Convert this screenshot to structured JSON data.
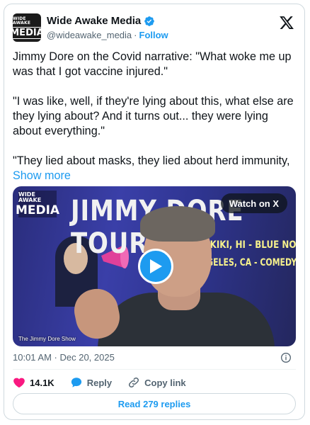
{
  "author": {
    "display_name": "Wide Awake Media",
    "handle": "@wideawake_media",
    "separator": "·",
    "follow_label": "Follow",
    "avatar_line1": "WIDE AWAKE",
    "avatar_line2": "MEDIA"
  },
  "tweet": {
    "paragraphs": [
      "Jimmy Dore on the Covid narrative: \"What woke me up was that I got vaccine injured.\"",
      "\"I was like, well, if they're lying about this, what else are they lying about? And it turns out... they were lying about everything.\"",
      "\"They lied about masks, they lied about herd immunity,"
    ],
    "show_more": "Show more"
  },
  "video": {
    "banner_title": "JIMMY DORE TOUR",
    "logo_line1": "WIDE AWAKE",
    "logo_line2": "MEDIA",
    "tour_line1": "AIKIKI, HI - BLUE NOTE",
    "tour_line2": "NGELES, CA - COMEDY STORE",
    "watch_label": "Watch on X",
    "caption": "The Jimmy Dore Show"
  },
  "meta": {
    "timestamp": "10:01 AM · Dec 20, 2025"
  },
  "actions": {
    "likes": "14.1K",
    "reply_label": "Reply",
    "copy_link_label": "Copy link"
  },
  "read_replies_label": "Read 279 replies",
  "colors": {
    "accent": "#1d9bf0",
    "like": "#f91880",
    "text": "#0f1419",
    "muted": "#536471"
  }
}
